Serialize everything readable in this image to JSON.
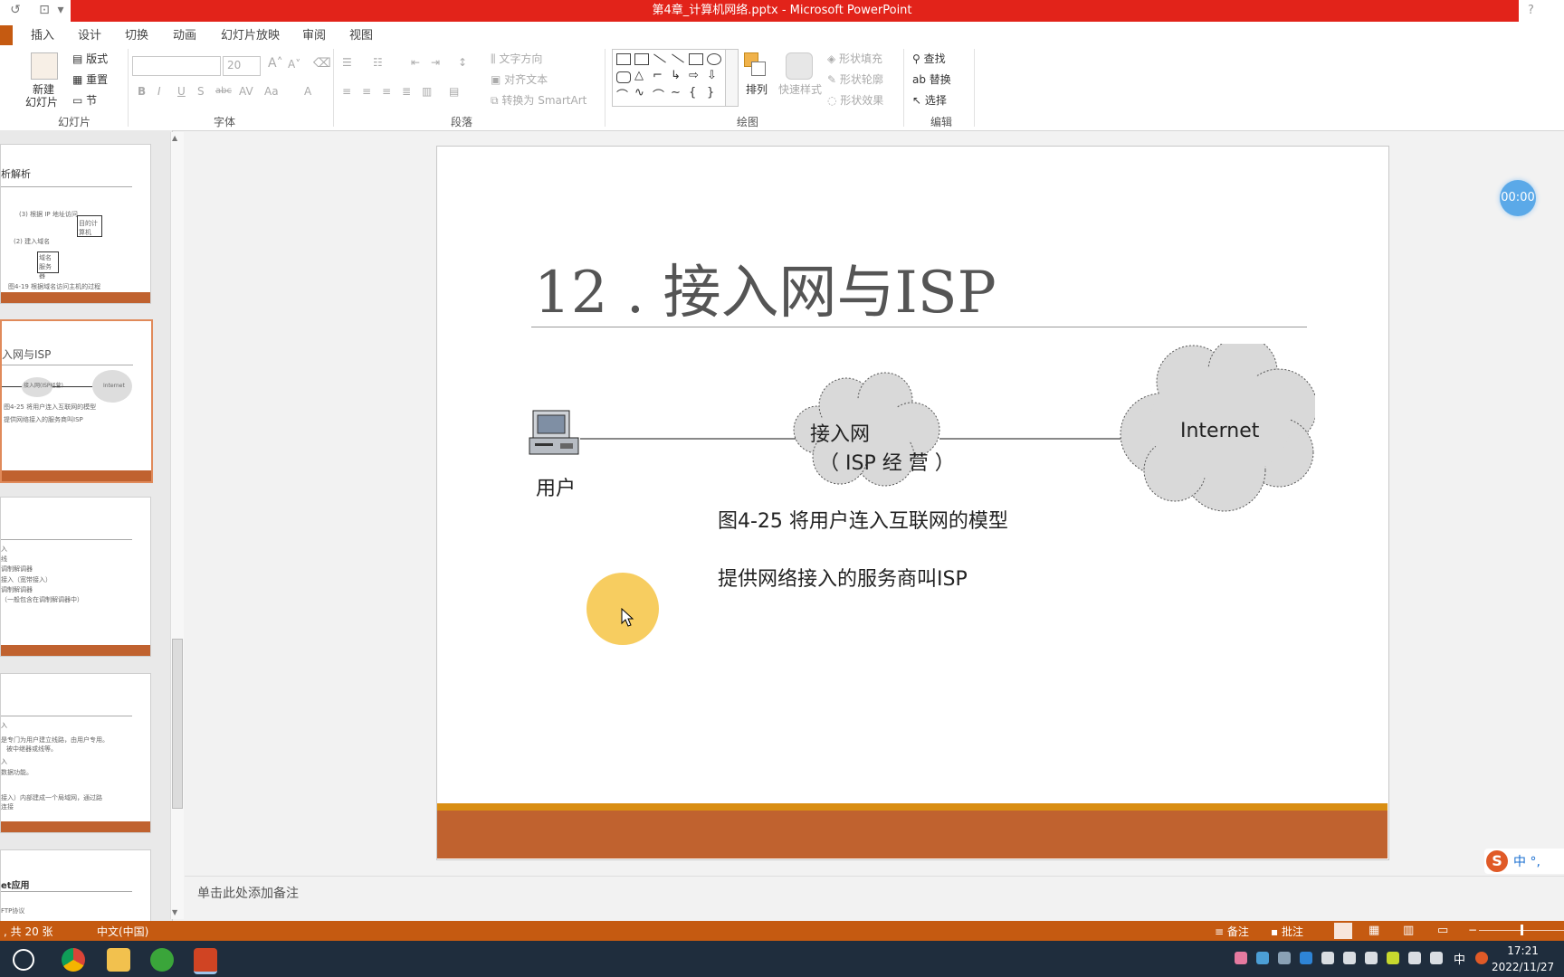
{
  "window": {
    "title": "第4章_计算机网络.pptx -  Microsoft PowerPoint",
    "help": "?"
  },
  "tabs": [
    "插入",
    "设计",
    "切换",
    "动画",
    "幻灯片放映",
    "审阅",
    "视图"
  ],
  "ribbon": {
    "slides_group": {
      "new_slide": "新建",
      "new_slide2": "幻灯片",
      "layout": "版式",
      "reset": "重置",
      "section": "节",
      "label": "幻灯片"
    },
    "font_group": {
      "font_size": "20",
      "label": "字体"
    },
    "paragraph_group": {
      "text_direction": "文字方向",
      "align_text": "对齐文本",
      "convert_smartart": "转换为 SmartArt",
      "label": "段落"
    },
    "drawing_group": {
      "arrange": "排列",
      "quick_styles": "快速样式",
      "shape_fill": "形状填充",
      "shape_outline": "形状轮廓",
      "shape_effects": "形状效果",
      "label": "绘图"
    },
    "editing_group": {
      "find": "查找",
      "replace": "替换",
      "select": "选择",
      "label": "编辑"
    }
  },
  "thumbnails": [
    {
      "title": "析解析",
      "diagram_a": "(3) 根据 IP 地址访问",
      "diagram_b": "(2) 建入域名",
      "box1": "目的计算机",
      "box2": "域名服务器",
      "caption": "图4-19 根据域名访问主机的过程"
    },
    {
      "title": "入网与ISP",
      "node": "接入网(ISP经营)",
      "cloud": "Internet",
      "caption": "图4-25 将用户连入互联网的模型",
      "line2": "提供网络接入的服务商叫ISP"
    },
    {
      "lines": [
        "入",
        "线",
        "调制解调器",
        "接入（宽带接入）",
        "调制解调器",
        "（一般包含在调制解调器中）"
      ]
    },
    {
      "lines": [
        "入",
        "是专门为用户建立线路，由用户专用。",
        "被中继器或线等。",
        "入",
        "数据功能。",
        "接入）内部建成一个局域网，通过路",
        "连接"
      ]
    },
    {
      "title": "et应用",
      "lines": [
        "FTP协议"
      ]
    }
  ],
  "slide": {
    "title": "12 . 接入网与ISP",
    "user_label": "用户",
    "access_net_line1": "接入网",
    "access_net_line2": "（ ISP 经 营 ）",
    "internet_label": "Internet",
    "caption": "图4-25  将用户连入互联网的模型",
    "body": "提供网络接入的服务商叫ISP"
  },
  "timer": "00:00",
  "notes_placeholder": "单击此处添加备注",
  "status": {
    "slide_count": ", 共 20 张",
    "language": "中文(中国)",
    "notes": "备注",
    "comments": "批注"
  },
  "ime": {
    "label": "中 °,"
  },
  "taskbar": {
    "time": "17:21",
    "date": "2022/11/27",
    "ime_lang": "中"
  },
  "colors": {
    "accent_orange": "#c55a11",
    "title_red": "#e2231a",
    "band_gold": "#d98e13",
    "pointer_yellow": "#f6c84f"
  }
}
